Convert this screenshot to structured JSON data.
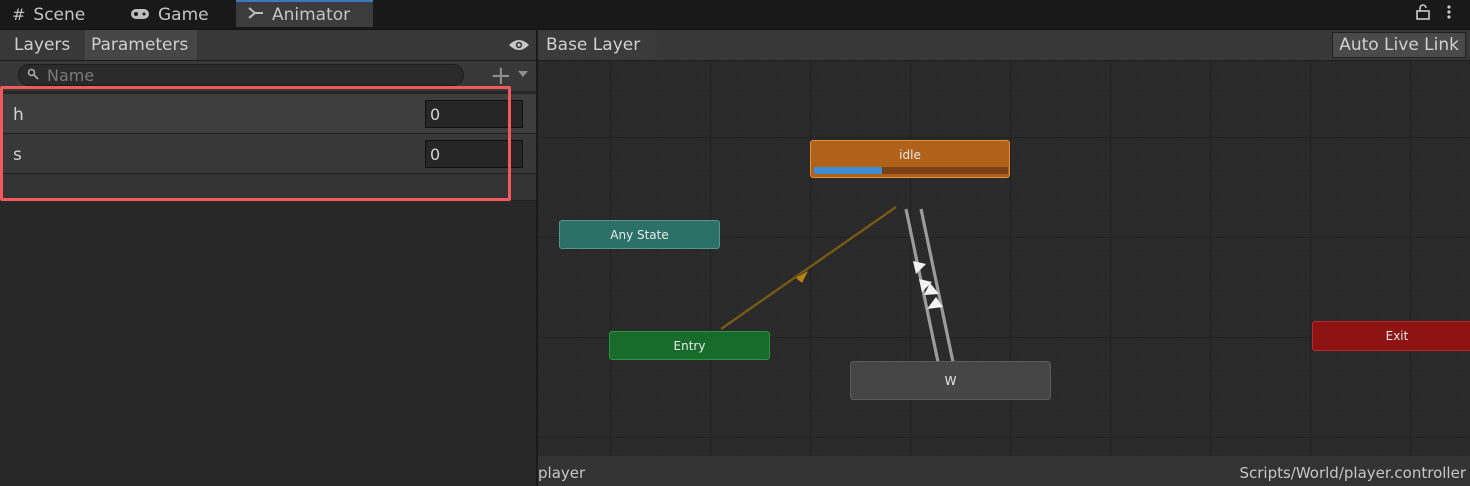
{
  "tabs": [
    {
      "label": "Scene",
      "icon": "grid-icon"
    },
    {
      "label": "Game",
      "icon": "gamepad-icon"
    },
    {
      "label": "Animator",
      "icon": "animator-icon"
    }
  ],
  "left_panel": {
    "tabs": [
      "Layers",
      "Parameters"
    ],
    "search_placeholder": "Name",
    "parameters": [
      {
        "name": "h",
        "value": "0"
      },
      {
        "name": "s",
        "value": "0"
      }
    ]
  },
  "graph": {
    "breadcrumb": "Base Layer",
    "auto_live_link": "Auto Live Link",
    "states": {
      "idle": "idle",
      "any_state": "Any State",
      "entry": "Entry",
      "w": "W",
      "exit": "Exit"
    },
    "idle_progress": 0.35
  },
  "status": {
    "left": "player",
    "right": "Scripts/World/player.controller"
  },
  "colors": {
    "accent": "#3a79bb",
    "highlight": "#f05a5e",
    "idle": "#b1621a",
    "any_state": "#2b7168",
    "entry": "#186c2b",
    "exit": "#8e1313"
  }
}
